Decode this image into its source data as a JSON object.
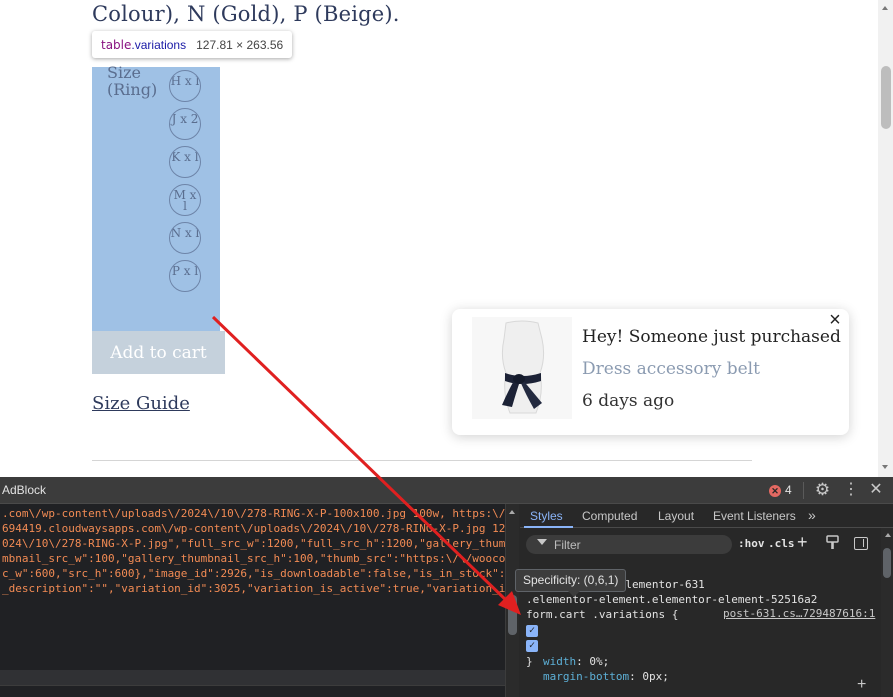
{
  "page": {
    "heading": "Colour), N (Gold), P (Beige).",
    "inspect_tooltip": {
      "tag": "table",
      "class": ".variations",
      "dimensions": "127.81 × 263.56"
    },
    "size_label": "Size (Ring)",
    "size_options": [
      "H x l",
      "J x 2",
      "K x l",
      "M x l",
      "N x l",
      "P x l"
    ],
    "add_to_cart_label": "Add to cart",
    "size_guide_label": "Size Guide"
  },
  "popup": {
    "title": "Hey! Someone just purchased",
    "product": "Dress accessory belt",
    "time_ago": "6 days ago",
    "close_label": "×"
  },
  "devtools": {
    "title": "AdBlock",
    "error_count": "4",
    "code_lines": [
      ".com\\/wp-content\\/uploads\\/2024\\/10\\/278-RING-X-P-100x100.jpg 100w, https:\\/",
      "694419.cloudwaysapps.com\\/wp-content\\/uploads\\/2024\\/10\\/278-RING-X-P.jpg 12",
      "024\\/10\\/278-RING-X-P.jpg\",\"full_src_w\":1200,\"full_src_h\":1200,\"gallery_thum",
      "mbnail_src_w\":100,\"gallery_thumbnail_src_h\":100,\"thumb_src\":\"https:\\/\\/wooco",
      "c_w\":600,\"src_h\":600},\"image_id\":2926,\"is_downloadable\":false,\"is_in_stock\":",
      "_description\":\"\",\"variation_id\":3025,\"variation_is_active\":true,\"variation_i"
    ],
    "tabs": [
      "Styles",
      "Computed",
      "Layout",
      "Event Listeners"
    ],
    "more_tabs": "»",
    "filter_placeholder": "Filter",
    "hov_label": ":hov",
    "cls_label": ".cls",
    "specificity_tooltip": "Specificity: (0,6,1)",
    "rule": {
      "selector_lines": [
        ".woocommerce .elementor-631",
        ".elementor-element.elementor-element-52516a2",
        "form.cart .variations {"
      ],
      "source": "post-631.cs…729487616:1",
      "declarations": [
        {
          "property": "width",
          "value": "0%;"
        },
        {
          "property": "margin-bottom",
          "value": "0px;"
        }
      ],
      "close": "}"
    }
  },
  "colors": {
    "highlight": "#9fc1e5",
    "accent_blue": "#8ab4f8",
    "code_orange": "#f28b54",
    "arrow_red": "#e02020"
  }
}
